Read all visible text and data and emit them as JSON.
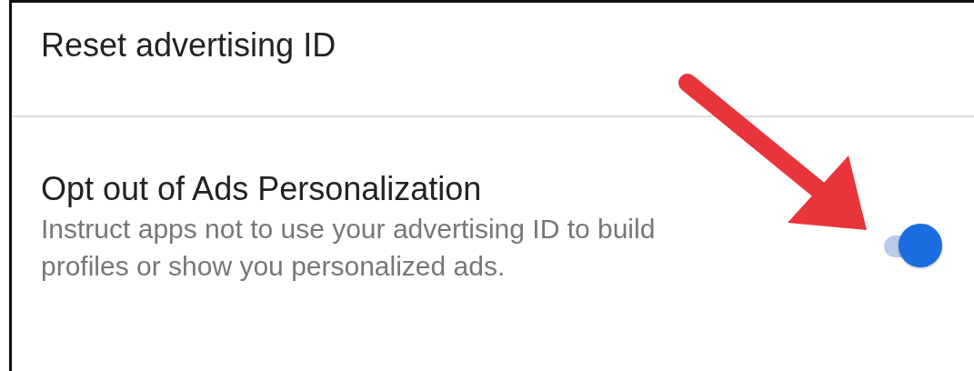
{
  "settings": [
    {
      "kind": "action",
      "title": "Reset advertising ID"
    },
    {
      "kind": "toggle",
      "title": "Opt out of Ads Personalization",
      "description": "Instruct apps not to use your advertising ID to build profiles or show you personalized ads.",
      "on": true
    }
  ]
}
